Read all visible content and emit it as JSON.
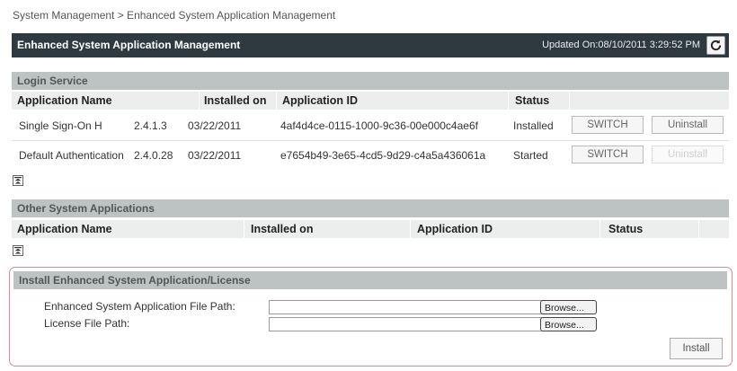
{
  "breadcrumb": "System Management > Enhanced System Application Management",
  "header": {
    "title": "Enhanced System Application Management",
    "updated": "Updated On:08/10/2011 3:29:52 PM"
  },
  "login_service": {
    "title": "Login Service",
    "columns": [
      "Application Name",
      "Installed on",
      "Application ID",
      "Status"
    ],
    "rows": [
      {
        "name": "Single Sign-On H",
        "version": "2.4.1.3",
        "installed_on": "03/22/2011",
        "app_id": "4af4d4ce-0115-1000-9c36-00e000c4ae6f",
        "status": "Installed",
        "switch_label": "SWITCH",
        "uninstall_label": "Uninstall"
      },
      {
        "name": "Default Authentication",
        "version": "2.4.0.28",
        "installed_on": "03/22/2011",
        "app_id": "e7654b49-3e65-4cd5-9d29-c4a5a436061a",
        "status": "Started",
        "switch_label": "SWITCH",
        "uninstall_label": "Uninstall"
      }
    ]
  },
  "other_apps": {
    "title": "Other System Applications",
    "columns": [
      "Application Name",
      "Installed on",
      "Application ID",
      "Status"
    ]
  },
  "install": {
    "title": "Install Enhanced System Application/License",
    "app_path_label": "Enhanced System Application File Path:",
    "app_path_value": "",
    "license_path_label": "License File Path:",
    "license_path_value": "",
    "browse_label": "Browse...",
    "install_label": "Install"
  },
  "colors": {
    "titlebar": "#2f3a40",
    "section_header": "#bdc3c3",
    "column_header": "#eceeee",
    "install_border": "#d88b95"
  }
}
